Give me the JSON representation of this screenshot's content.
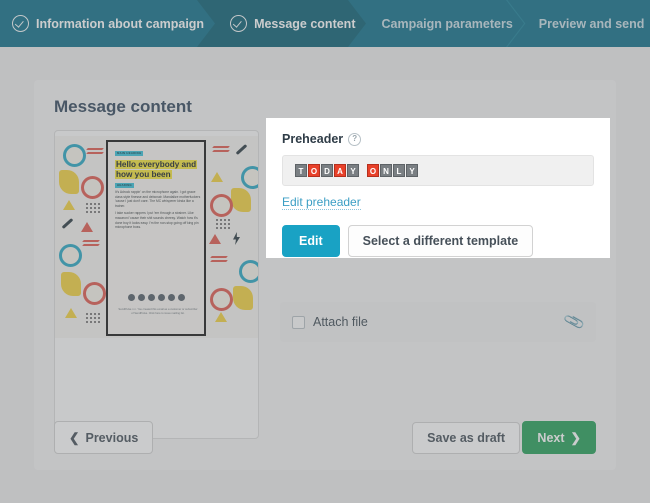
{
  "steps": [
    {
      "label": "Information about campaign",
      "state": "done",
      "icon": "check-circle-icon"
    },
    {
      "label": "Message content",
      "state": "active",
      "icon": "check-circle-icon"
    },
    {
      "label": "Campaign parameters",
      "state": "upcoming",
      "icon": ""
    },
    {
      "label": "Preview and send",
      "state": "upcoming",
      "icon": ""
    }
  ],
  "card": {
    "title": "Message content"
  },
  "template_preview": {
    "eyebrow_top": "MAIN HEADING",
    "heading": "Hello everybody and how you been",
    "eyebrow_body": "HEADING",
    "body": [
      "It's Adrock rappin' on the microphone again. I got grace class style finesse and debonair. Mandalize motherfuckers 'cause I just don't care. The MC whisperer kinda like a trainer.",
      "I take sucker rappers I put 'em through a strainer. Like macaroni 'cause their shit sounds cheesy. Watch how it's done boy it looks easy. I'm the non-stop going off king pin microphone boss."
    ],
    "social_count": 6,
    "footer": "SendPulse n n. You created this email as a customer or subscriber of SendPulse. Click here to issue mailing list."
  },
  "attach": {
    "label": "Attach file",
    "checked": false,
    "icon": "paperclip-icon"
  },
  "preheader": {
    "title": "Preheader",
    "help_icon": "question-mark-icon",
    "value": "TODAY ONLY",
    "tiles": [
      {
        "ch": "T",
        "hot": false
      },
      {
        "ch": "O",
        "hot": true
      },
      {
        "ch": "D",
        "hot": false
      },
      {
        "ch": "A",
        "hot": true
      },
      {
        "ch": "Y",
        "hot": false
      },
      {
        "ch": "",
        "gap": true
      },
      {
        "ch": "O",
        "hot": true
      },
      {
        "ch": "N",
        "hot": false
      },
      {
        "ch": "L",
        "hot": false
      },
      {
        "ch": "Y",
        "hot": false
      }
    ],
    "edit_link": "Edit preheader",
    "edit_button": "Edit",
    "select_template_button": "Select a different template"
  },
  "footer_bar": {
    "previous": "Previous",
    "previous_icon": "chevron-left-icon",
    "save_draft": "Save as draft",
    "next": "Next",
    "next_icon": "chevron-right-icon"
  },
  "colors": {
    "stepbar": "#10708a",
    "stepbar_active": "#0b6075",
    "edit_button": "#19a2c4",
    "next_button": "#27a05a",
    "tile_hot": "#e8412a",
    "tile_normal": "#7a7f83"
  }
}
